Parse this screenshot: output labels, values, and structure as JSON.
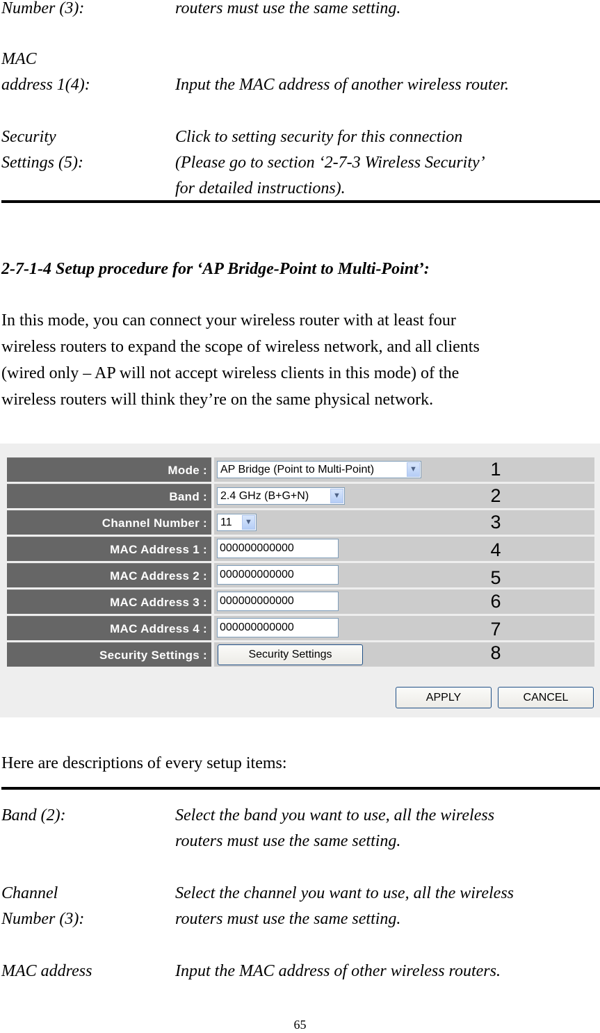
{
  "top_section": {
    "items": [
      {
        "term_lines": [
          "Number (3):"
        ],
        "desc_lines": [
          "routers must use the same setting."
        ]
      },
      {
        "term_lines": [
          "MAC",
          "address 1(4):"
        ],
        "desc_lines": [
          "",
          "Input the MAC address of another wireless router."
        ]
      },
      {
        "term_lines": [
          "Security",
          "Settings (5):",
          ""
        ],
        "desc_lines": [
          "Click to setting security for this connection",
          "(Please go to section ‘2-7-3 Wireless Security’",
          "for detailed instructions)."
        ]
      }
    ]
  },
  "section": {
    "heading": "2-7-1-4 Setup procedure for ‘AP Bridge-Point to Multi-Point’:",
    "paragraph_lines": [
      "In this mode, you can connect your wireless router with at least four",
      "wireless routers to expand the scope of wireless network, and all clients",
      "(wired only – AP will not accept wireless clients in this mode) of the",
      "wireless routers will think they’re on the same physical network."
    ]
  },
  "form": {
    "rows": [
      {
        "label": "Mode :",
        "type": "select",
        "value": "AP Bridge (Point to Multi-Point)",
        "callout": "1"
      },
      {
        "label": "Band :",
        "type": "select",
        "value": "2.4 GHz (B+G+N)",
        "callout": "2"
      },
      {
        "label": "Channel Number :",
        "type": "select",
        "value": "11",
        "callout": "3"
      },
      {
        "label": "MAC Address 1 :",
        "type": "text",
        "value": "000000000000",
        "callout": "4"
      },
      {
        "label": "MAC Address 2 :",
        "type": "text",
        "value": "000000000000",
        "callout": "5"
      },
      {
        "label": "MAC Address 3 :",
        "type": "text",
        "value": "000000000000",
        "callout": "6"
      },
      {
        "label": "MAC Address 4 :",
        "type": "text",
        "value": "000000000000",
        "callout": "7"
      },
      {
        "label": "Security Settings :",
        "type": "button",
        "value": "Security Settings",
        "callout": "8"
      }
    ],
    "apply_label": "APPLY",
    "cancel_label": "CANCEL",
    "colors": {
      "label_bg": "#666666",
      "value_bg": "#cccccc",
      "panel_bg": "#eeeeee"
    }
  },
  "descriptions": {
    "intro": "Here are descriptions of every setup items:",
    "items": [
      {
        "term_lines": [
          "Band (2):",
          ""
        ],
        "desc_lines": [
          "Select the band you want to use, all the wireless",
          "routers must use the same setting."
        ]
      },
      {
        "term_lines": [
          "Channel",
          "Number (3):"
        ],
        "desc_lines": [
          "Select the channel you want to use, all the wireless",
          "routers must use the same setting."
        ]
      },
      {
        "term_lines": [
          "MAC address"
        ],
        "desc_lines": [
          "Input the MAC address of other wireless routers."
        ]
      }
    ]
  },
  "page_number": "65"
}
